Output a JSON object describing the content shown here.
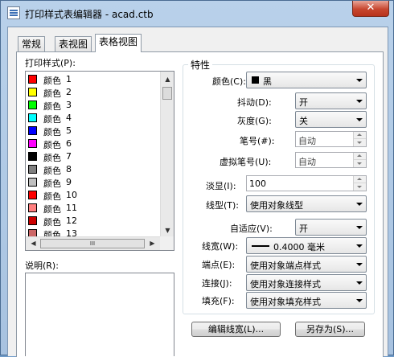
{
  "window": {
    "title": "打印样式表编辑器 - acad.ctb",
    "close_glyph": "✕"
  },
  "tabs": [
    {
      "label": "常规"
    },
    {
      "label": "表视图"
    },
    {
      "label": "表格视图"
    }
  ],
  "styles_panel": {
    "label": "打印样式(P):",
    "items": [
      {
        "name": "颜色",
        "num": "1",
        "color": "#ff0000"
      },
      {
        "name": "颜色",
        "num": "2",
        "color": "#ffff00"
      },
      {
        "name": "颜色",
        "num": "3",
        "color": "#00ff00"
      },
      {
        "name": "颜色",
        "num": "4",
        "color": "#00ffff"
      },
      {
        "name": "颜色",
        "num": "5",
        "color": "#0000ff"
      },
      {
        "name": "颜色",
        "num": "6",
        "color": "#ff00ff"
      },
      {
        "name": "颜色",
        "num": "7",
        "color": "#000000"
      },
      {
        "name": "颜色",
        "num": "8",
        "color": "#808080"
      },
      {
        "name": "颜色",
        "num": "9",
        "color": "#c0c0c0"
      },
      {
        "name": "颜色",
        "num": "10",
        "color": "#ff0000"
      },
      {
        "name": "颜色",
        "num": "11",
        "color": "#ff7f7f"
      },
      {
        "name": "颜色",
        "num": "12",
        "color": "#cc0000"
      },
      {
        "name": "颜色",
        "num": "13",
        "color": "#cc6666"
      }
    ],
    "hscroll_glyph": "III"
  },
  "description": {
    "label": "说明(R):",
    "value": ""
  },
  "properties": {
    "group_title": "特性",
    "color": {
      "label": "颜色(C):",
      "value": "黑",
      "chip": "#000000"
    },
    "dither": {
      "label": "抖动(D):",
      "value": "开"
    },
    "grayscale": {
      "label": "灰度(G):",
      "value": "关"
    },
    "pen_number": {
      "label": "笔号(#):",
      "value": "自动"
    },
    "virtual_pen": {
      "label": "虚拟笔号(U):",
      "value": "自动"
    },
    "screening": {
      "label": "淡显(I):",
      "value": "100"
    },
    "linetype": {
      "label": "线型(T):",
      "value": "使用对象线型"
    },
    "adaptive": {
      "label": "自适应(V):",
      "value": "开"
    },
    "lineweight": {
      "label": "线宽(W):",
      "value": "0.4000 毫米"
    },
    "line_end": {
      "label": "端点(E):",
      "value": "使用对象端点样式"
    },
    "line_join": {
      "label": "连接(J):",
      "value": "使用对象连接样式"
    },
    "fill": {
      "label": "填充(F):",
      "value": "使用对象填充样式"
    }
  },
  "buttons": {
    "edit_lineweights": "编辑线宽(L)...",
    "save_as": "另存为(S)..."
  }
}
